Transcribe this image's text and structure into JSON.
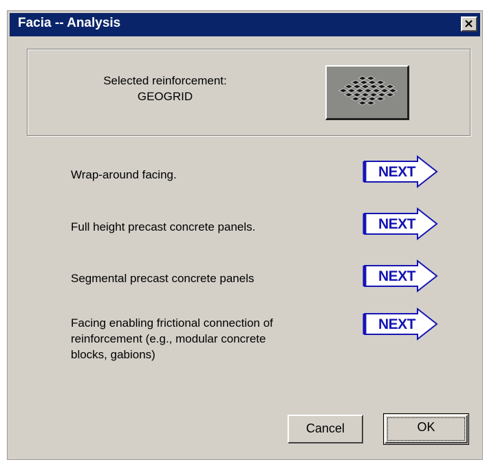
{
  "window": {
    "title": "Facia -- Analysis",
    "close_glyph": "✕",
    "close_icon": "close-icon"
  },
  "reinforcement": {
    "caption": "Selected reinforcement:",
    "value": "GEOGRID",
    "icon": "geogrid-icon"
  },
  "options": [
    {
      "label": "Wrap-around  facing.",
      "next_label": "NEXT"
    },
    {
      "label": "Full height precast concrete panels.",
      "next_label": "NEXT"
    },
    {
      "label": "Segmental  precast concrete panels",
      "next_label": "NEXT"
    },
    {
      "label_lines": [
        "Facing enabling frictional connection of",
        "reinforcement  (e.g., modular concrete",
        "blocks, gabions)"
      ],
      "next_label": "NEXT"
    }
  ],
  "buttons": {
    "cancel": "Cancel",
    "ok": "OK"
  },
  "colors": {
    "titlebar": "#0a246a",
    "dialog_bg": "#d4d0c8",
    "next_text": "#1414b4"
  }
}
